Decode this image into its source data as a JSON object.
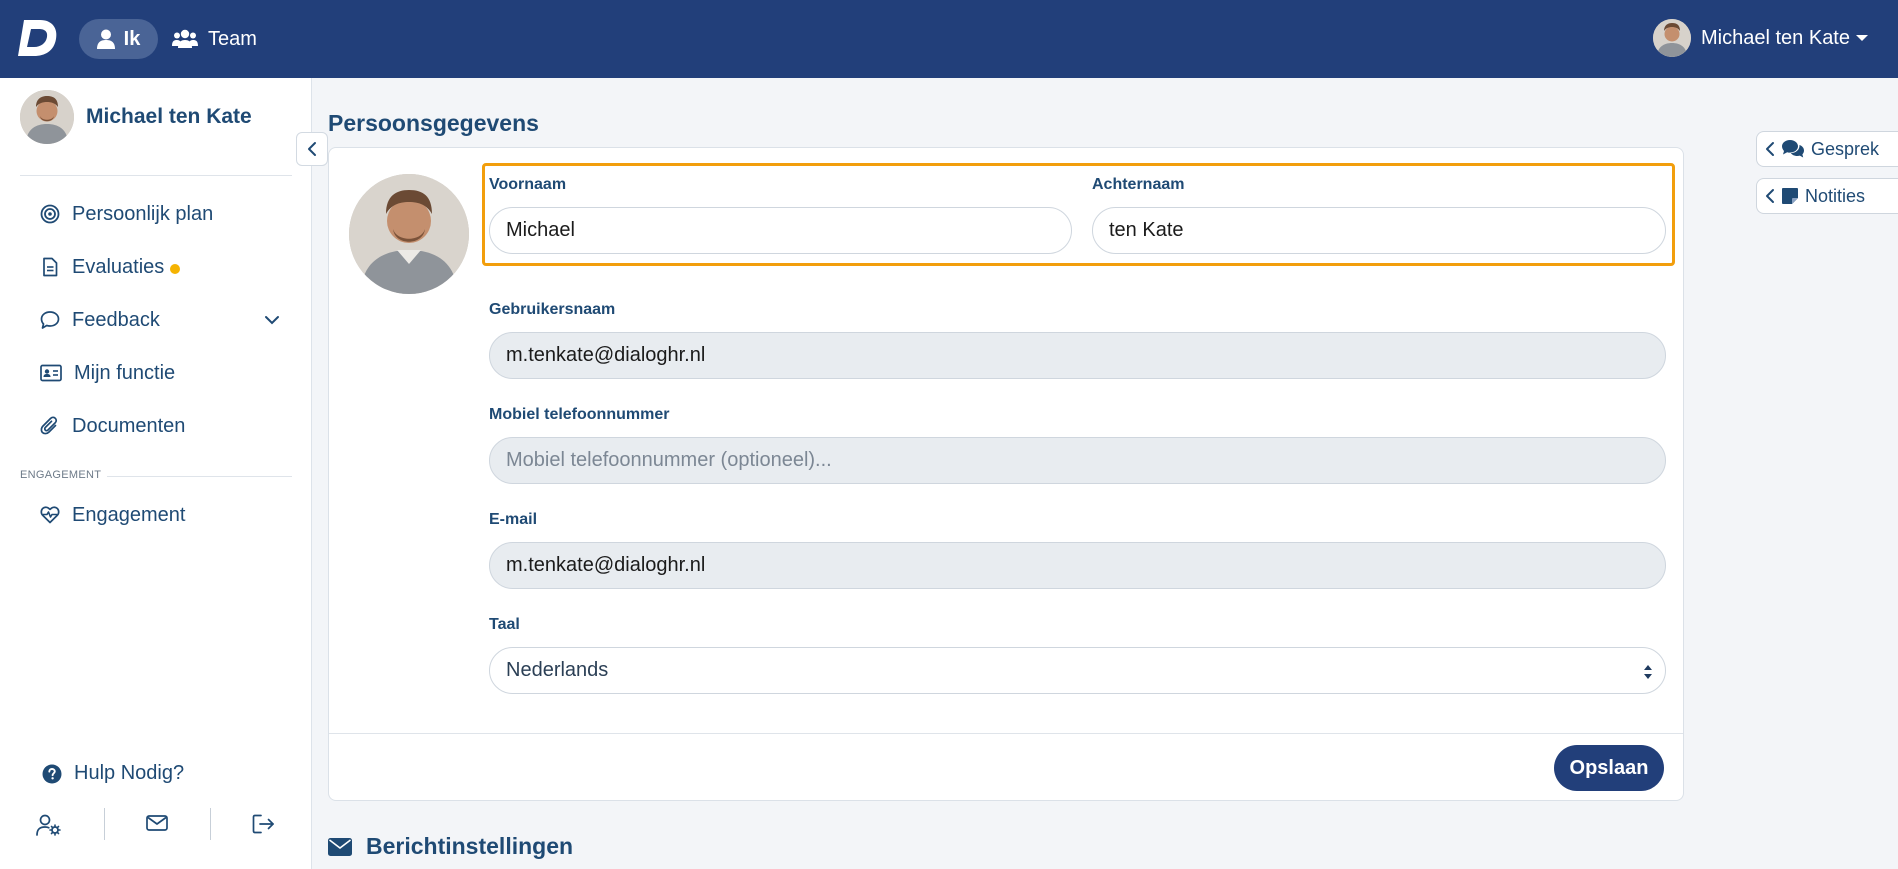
{
  "header": {
    "logo_letter": "D",
    "tabs": [
      {
        "label": "Ik",
        "active": true
      },
      {
        "label": "Team",
        "active": false
      }
    ],
    "user_name": "Michael ten Kate",
    "brand_color": "#223f7a"
  },
  "sidebar": {
    "user_name": "Michael ten Kate",
    "items": [
      {
        "label": "Persoonlijk plan",
        "icon": "target-icon"
      },
      {
        "label": "Evaluaties",
        "icon": "document-icon",
        "badge_dot": true
      },
      {
        "label": "Feedback",
        "icon": "chat-bubble-icon",
        "expandable": true
      },
      {
        "label": "Mijn functie",
        "icon": "id-card-icon"
      },
      {
        "label": "Documenten",
        "icon": "paperclip-icon"
      }
    ],
    "section_label": "ENGAGEMENT",
    "section_items": [
      {
        "label": "Engagement",
        "icon": "heart-pulse-icon"
      }
    ],
    "help_label": "Hulp Nodig?",
    "footer_icons": [
      "user-settings-icon",
      "mail-icon",
      "logout-icon"
    ]
  },
  "main": {
    "title": "Persoonsgegevens",
    "form": {
      "first_name": {
        "label": "Voornaam",
        "value": "Michael"
      },
      "last_name": {
        "label": "Achternaam",
        "value": "ten Kate"
      },
      "username": {
        "label": "Gebruikersnaam",
        "value": "m.tenkate@dialoghr.nl"
      },
      "mobile": {
        "label": "Mobiel telefoonnummer",
        "value": "",
        "placeholder": "Mobiel telefoonnummer (optioneel)..."
      },
      "email": {
        "label": "E-mail",
        "value": "m.tenkate@dialoghr.nl"
      },
      "language": {
        "label": "Taal",
        "value": "Nederlands"
      }
    },
    "save_label": "Opslaan",
    "next_section_title": "Berichtinstellingen"
  },
  "right_tabs": [
    {
      "label": "Gesprek",
      "icon": "comments-icon"
    },
    {
      "label": "Notities",
      "icon": "note-icon"
    }
  ],
  "colors": {
    "highlight": "#f29e0c",
    "badge": "#f5b301",
    "text_primary": "#1f4a74"
  }
}
